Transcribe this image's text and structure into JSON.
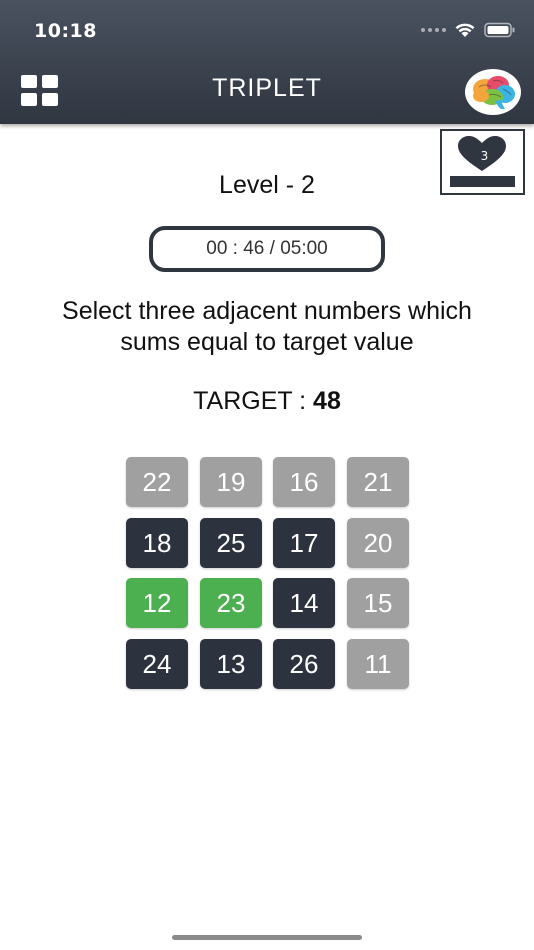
{
  "status_bar": {
    "time": "10:18"
  },
  "header": {
    "title": "TRIPLET",
    "menu_icon": "grid-menu-icon",
    "brain_icon": "brain-icon"
  },
  "lives": {
    "count": "3",
    "icon": "heart-icon"
  },
  "game": {
    "level_label": "Level - 2",
    "timer": "00 : 46 / 05:00",
    "instruction_line1": "Select three adjacent numbers which",
    "instruction_line2": "sums equal to target value",
    "target_label": "TARGET : ",
    "target_value": "48"
  },
  "grid": {
    "rows": [
      [
        {
          "value": "22",
          "state": "gray"
        },
        {
          "value": "19",
          "state": "gray"
        },
        {
          "value": "16",
          "state": "gray"
        },
        {
          "value": "21",
          "state": "gray"
        }
      ],
      [
        {
          "value": "18",
          "state": "dark"
        },
        {
          "value": "25",
          "state": "dark"
        },
        {
          "value": "17",
          "state": "dark"
        },
        {
          "value": "20",
          "state": "gray"
        }
      ],
      [
        {
          "value": "12",
          "state": "green"
        },
        {
          "value": "23",
          "state": "green"
        },
        {
          "value": "14",
          "state": "dark"
        },
        {
          "value": "15",
          "state": "gray"
        }
      ],
      [
        {
          "value": "24",
          "state": "dark"
        },
        {
          "value": "13",
          "state": "dark"
        },
        {
          "value": "26",
          "state": "dark"
        },
        {
          "value": "11",
          "state": "gray"
        }
      ]
    ]
  },
  "colors": {
    "header": "#2f3640",
    "tile_gray": "#a0a0a0",
    "tile_dark": "#2c333f",
    "tile_green": "#4caf50"
  }
}
